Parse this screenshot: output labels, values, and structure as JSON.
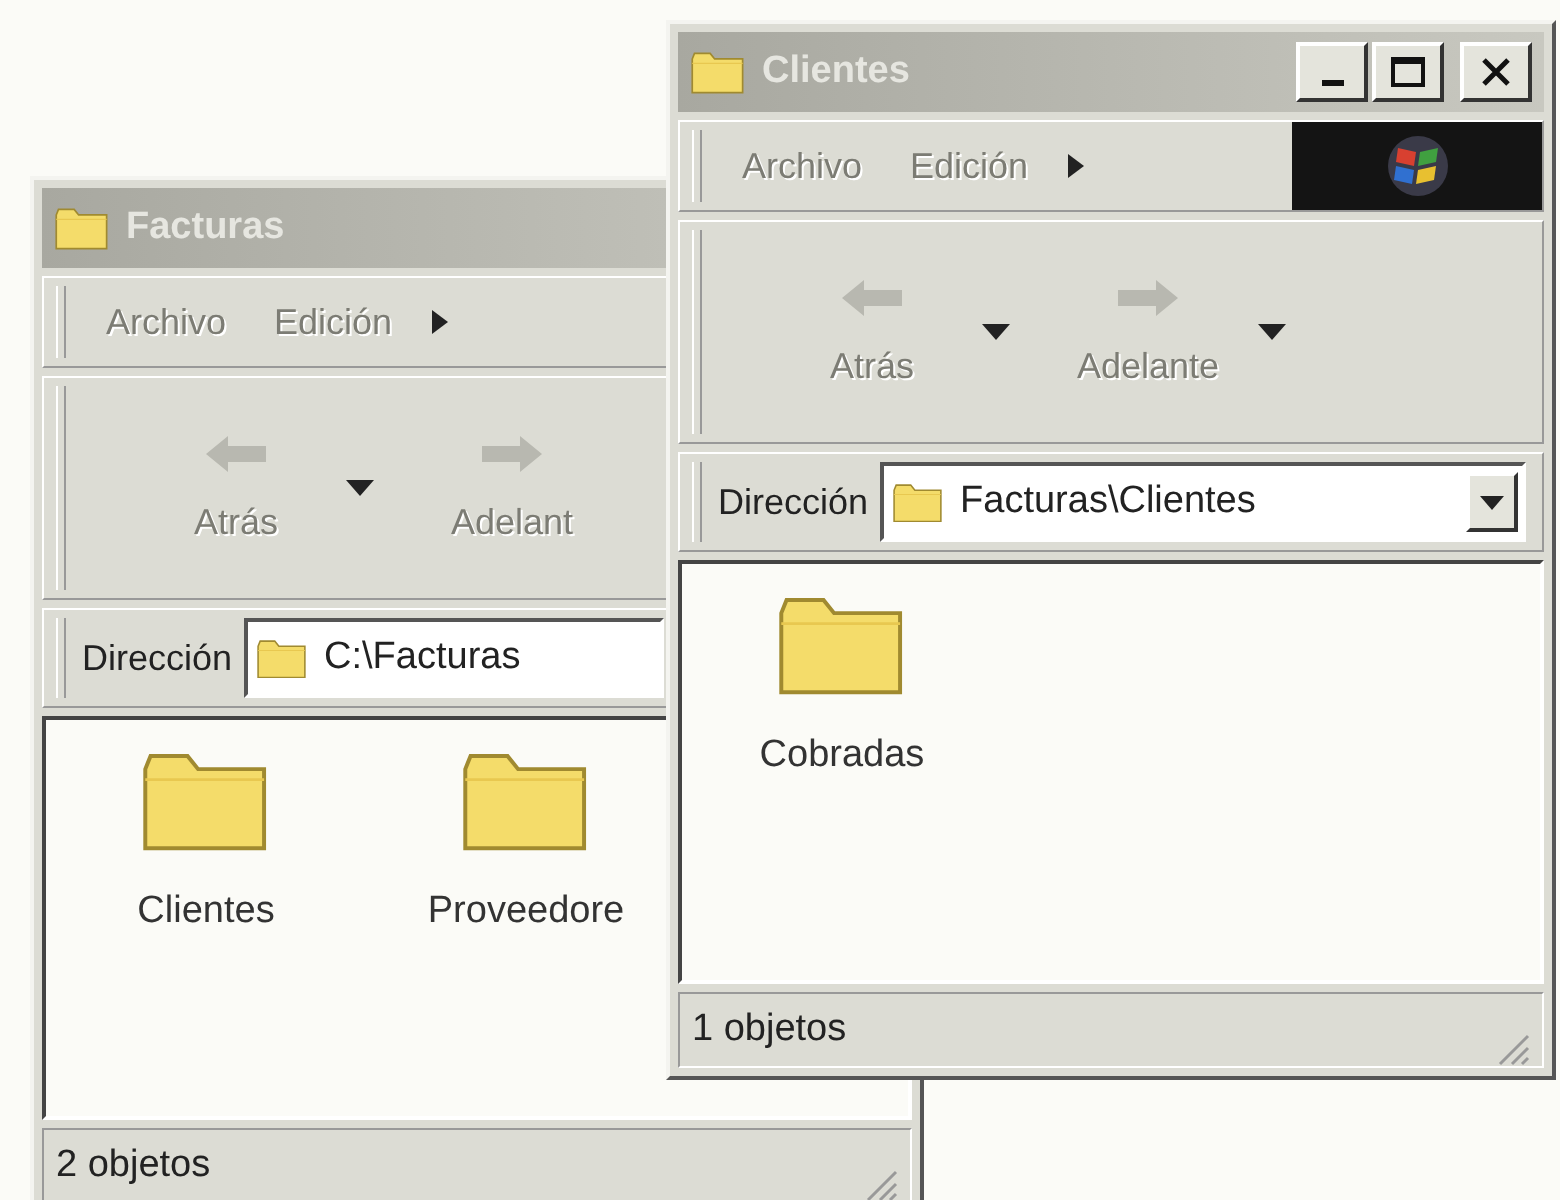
{
  "windows": [
    {
      "title": "Facturas",
      "active": false,
      "menu": [
        {
          "label": "Archivo",
          "disabled": true
        },
        {
          "label": "Edición",
          "disabled": true
        }
      ],
      "toolbar": [
        {
          "label": "Atrás",
          "disabled": true,
          "dropdown": true
        },
        {
          "label": "Adelant",
          "disabled": true
        }
      ],
      "address": {
        "label": "Dirección",
        "value": "C:\\Facturas"
      },
      "items": [
        {
          "name": "Clientes"
        },
        {
          "name": "Proveedore"
        }
      ],
      "status": "2 objetos"
    },
    {
      "title": "Clientes",
      "active": false,
      "caption_buttons": true,
      "logo": true,
      "menu": [
        {
          "label": "Archivo",
          "disabled": true
        },
        {
          "label": "Edición",
          "disabled": true
        }
      ],
      "toolbar": [
        {
          "label": "Atrás",
          "disabled": true,
          "dropdown": true
        },
        {
          "label": "Adelante",
          "disabled": true,
          "dropdown": true
        }
      ],
      "address": {
        "label": "Dirección",
        "value": "Facturas\\Clientes",
        "dropdown": true
      },
      "items": [
        {
          "name": "Cobradas"
        }
      ],
      "status": "1 objetos"
    }
  ]
}
